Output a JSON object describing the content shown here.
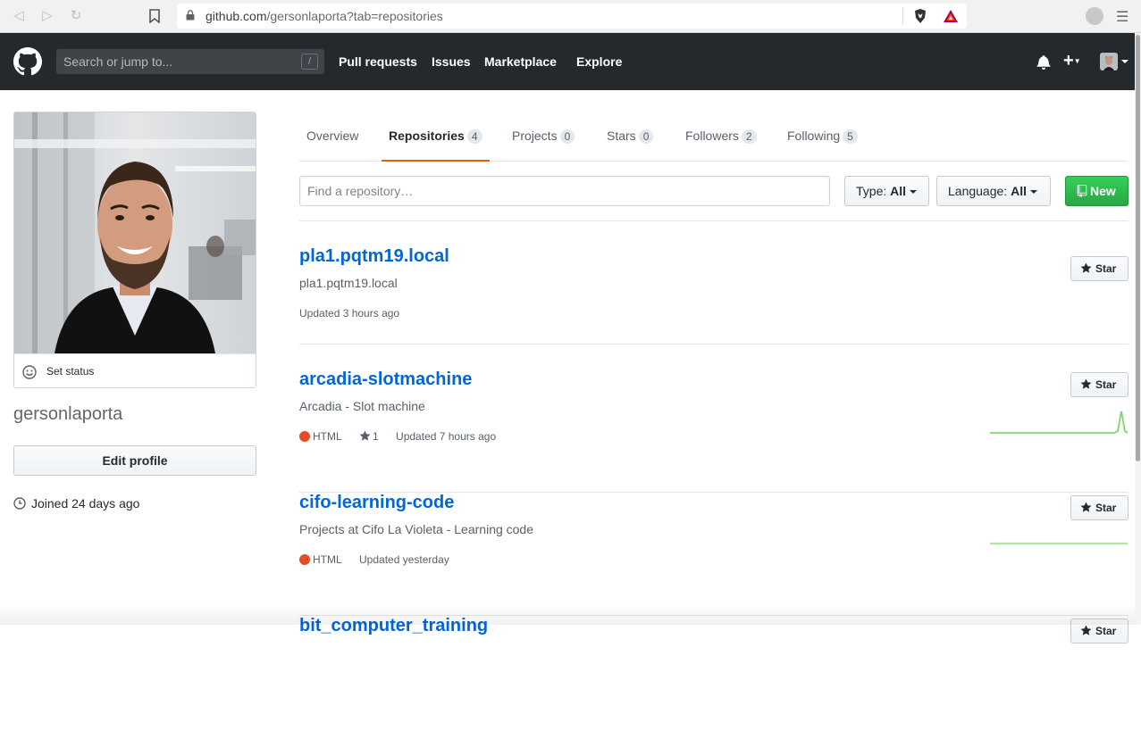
{
  "browser": {
    "url_host": "github.com",
    "url_path": "/gersonlaporta?tab=repositories"
  },
  "header": {
    "search_placeholder": "Search or jump to...",
    "search_shortcut": "/",
    "nav": [
      "Pull requests",
      "Issues",
      "Marketplace",
      "Explore"
    ],
    "plus_label": "+"
  },
  "sidebar": {
    "set_status": "Set status",
    "username": "gersonlaporta",
    "edit_profile": "Edit profile",
    "joined": "Joined 24 days ago"
  },
  "tabs": [
    {
      "label": "Overview",
      "count": null
    },
    {
      "label": "Repositories",
      "count": "4"
    },
    {
      "label": "Projects",
      "count": "0"
    },
    {
      "label": "Stars",
      "count": "0"
    },
    {
      "label": "Followers",
      "count": "2"
    },
    {
      "label": "Following",
      "count": "5"
    }
  ],
  "filters": {
    "find_placeholder": "Find a repository…",
    "type_label": "Type:",
    "type_value": "All",
    "language_label": "Language:",
    "language_value": "All",
    "new_label": "New"
  },
  "repos": [
    {
      "name": "pla1.pqtm19.local",
      "description": "pla1.pqtm19.local",
      "language": "",
      "stars": "",
      "updated": "Updated 3 hours ago",
      "star_label": "Star"
    },
    {
      "name": "arcadia-slotmachine",
      "description": "Arcadia - Slot machine",
      "language": "HTML",
      "stars": "1",
      "updated": "Updated 7 hours ago",
      "star_label": "Star"
    },
    {
      "name": "cifo-learning-code",
      "description": "Projects at Cifo La Violeta - Learning code",
      "language": "HTML",
      "stars": "",
      "updated": "Updated yesterday",
      "star_label": "Star"
    },
    {
      "name": "bit_computer_training",
      "description": "",
      "language": "",
      "stars": "",
      "updated": "",
      "star_label": "Star"
    }
  ],
  "colors": {
    "header_bg": "#24292e",
    "link": "#0366d6",
    "tab_underline": "#e36209",
    "new_button": "#28a745",
    "html_lang": "#e34c26",
    "sparkline": "#2cbe4e"
  }
}
